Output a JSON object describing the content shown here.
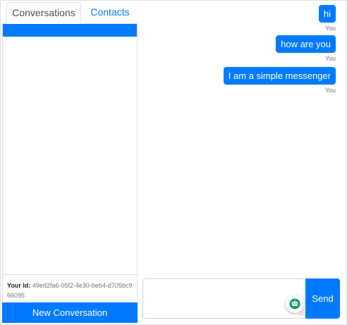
{
  "tabs": [
    {
      "label": "Conversations",
      "active": true
    },
    {
      "label": "Contacts",
      "active": false
    }
  ],
  "sidebar": {
    "user_id_label": "Your Id:",
    "user_id_value": "49ed2fa6-05f2-4e30-beb4-d705bc966095",
    "new_conversation_label": "New Conversation"
  },
  "messages": [
    {
      "text": "hi",
      "sender": "You"
    },
    {
      "text": "how are you",
      "sender": "You"
    },
    {
      "text": "I am a simple messenger",
      "sender": "You"
    }
  ],
  "composer": {
    "value": "",
    "send_label": "Send"
  },
  "colors": {
    "accent": "#007bff",
    "border": "#dee2e6",
    "muted": "#6c757d"
  },
  "icons": [
    "robot-assistant-icon",
    "resize-grip-icon"
  ]
}
